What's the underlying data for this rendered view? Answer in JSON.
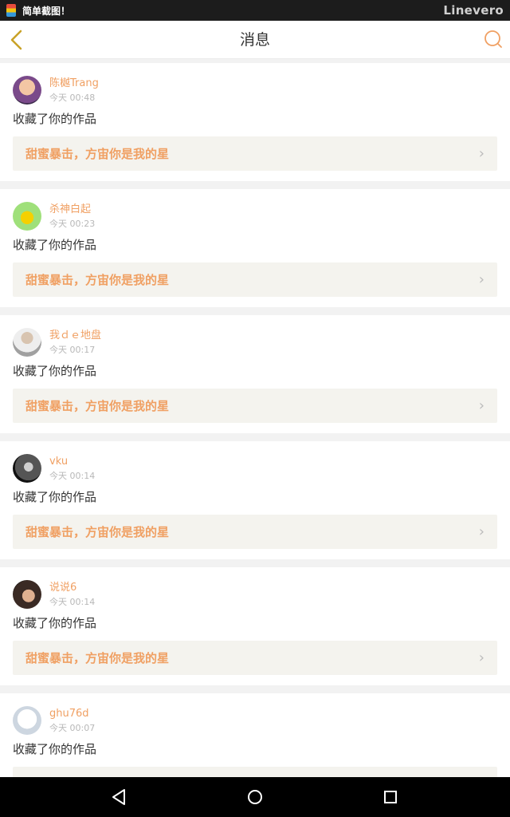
{
  "status_bar": {
    "app_name": "简单截图！",
    "brand": "Linevero"
  },
  "header": {
    "title": "消息"
  },
  "messages": [
    {
      "name": "陈樾Trang",
      "time": "今天 00:48",
      "action": "收藏了你的作品",
      "work_title": "甜蜜暴击，方宙你是我的星"
    },
    {
      "name": "杀神白起",
      "time": "今天 00:23",
      "action": "收藏了你的作品",
      "work_title": "甜蜜暴击，方宙你是我的星"
    },
    {
      "name": "我ｄｅ地盘",
      "time": "今天 00:17",
      "action": "收藏了你的作品",
      "work_title": "甜蜜暴击，方宙你是我的星"
    },
    {
      "name": "vku",
      "time": "今天 00:14",
      "action": "收藏了你的作品",
      "work_title": "甜蜜暴击，方宙你是我的星"
    },
    {
      "name": "说说6",
      "time": "今天 00:14",
      "action": "收藏了你的作品",
      "work_title": "甜蜜暴击，方宙你是我的星"
    },
    {
      "name": "ghu76d",
      "time": "今天 00:07",
      "action": "收藏了你的作品",
      "work_title": ""
    }
  ],
  "colors": {
    "accent": "#f0a063",
    "card_bg": "#ffffff",
    "work_bg": "#f4f3ee"
  }
}
